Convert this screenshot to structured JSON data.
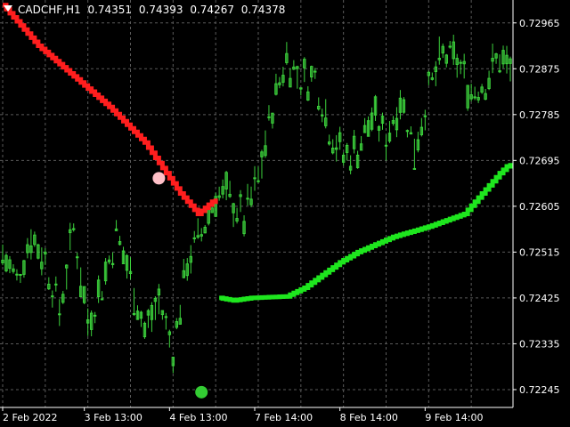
{
  "header": {
    "symbol": "CADCHF,H1",
    "open": "0.74351",
    "high": "0.74393",
    "low": "0.74267",
    "close": "0.74378"
  },
  "colors": {
    "background": "#000000",
    "grid": "#5a5a5a",
    "candle": "#3cd23c",
    "upper_band": "#ff1e1e",
    "lower_band": "#1ee61e",
    "sell_dot": "#ffc0c8",
    "buy_dot": "#33cc33",
    "axis_text": "#ffffff"
  },
  "chart_data": {
    "type": "line",
    "y_tick_labels": [
      "0.72965",
      "0.72875",
      "0.72785",
      "0.72695",
      "0.72605",
      "0.72515",
      "0.72425",
      "0.72335",
      "0.72245"
    ],
    "y_ticks": [
      0.72965,
      0.72875,
      0.72785,
      0.72695,
      0.72605,
      0.72515,
      0.72425,
      0.72335,
      0.72245
    ],
    "ylim": [
      0.7221,
      0.7301
    ],
    "x_tick_labels": [
      "2 Feb 2022",
      "3 Feb 13:00",
      "4 Feb 13:00",
      "7 Feb 14:00",
      "8 Feb 14:00",
      "9 Feb 14:00"
    ],
    "x_tick_bars": [
      0,
      23,
      47,
      71,
      95,
      119
    ],
    "n_bars": 144,
    "grid": true,
    "price_series": {
      "bar_index": [
        0,
        4,
        8,
        12,
        16,
        20,
        24,
        28,
        32,
        36,
        40,
        44,
        48,
        52,
        56,
        60,
        64,
        68,
        72,
        76,
        80,
        84,
        88,
        92,
        96,
        100,
        104,
        108,
        112,
        116,
        120,
        124,
        128,
        132,
        136,
        140,
        143
      ],
      "value": [
        0.7251,
        0.7246,
        0.7255,
        0.725,
        0.724,
        0.7256,
        0.7238,
        0.7245,
        0.7255,
        0.7247,
        0.7236,
        0.7242,
        0.7232,
        0.725,
        0.7255,
        0.7263,
        0.7262,
        0.7258,
        0.7266,
        0.728,
        0.729,
        0.7285,
        0.7286,
        0.7276,
        0.727,
        0.7272,
        0.7278,
        0.7274,
        0.7282,
        0.7272,
        0.7283,
        0.729,
        0.7289,
        0.7283,
        0.7285,
        0.729,
        0.7287
      ],
      "high_low_band": 0.0003
    },
    "series": [
      {
        "role": "upper_band",
        "color": "#ff1e1e",
        "bar_index": [
          0,
          10,
          20,
          30,
          40,
          45,
          50,
          55,
          60
        ],
        "value": [
          0.73,
          0.7292,
          0.7286,
          0.728,
          0.7273,
          0.7268,
          0.7263,
          0.7259,
          0.7262
        ]
      },
      {
        "role": "lower_band",
        "color": "#1ee61e",
        "bar_index": [
          61,
          65,
          70,
          80,
          85,
          90,
          95,
          100,
          110,
          120,
          130,
          135,
          140,
          143
        ],
        "value": [
          0.72425,
          0.7242,
          0.72425,
          0.72428,
          0.72445,
          0.7247,
          0.72495,
          0.72515,
          0.72545,
          0.72565,
          0.7259,
          0.7263,
          0.7267,
          0.7269
        ]
      }
    ],
    "markers": [
      {
        "role": "sell",
        "bar_index": 44,
        "value": 0.7266,
        "color": "#ffc0c8"
      },
      {
        "role": "buy",
        "bar_index": 56,
        "value": 0.7224,
        "color": "#33cc33"
      }
    ]
  }
}
